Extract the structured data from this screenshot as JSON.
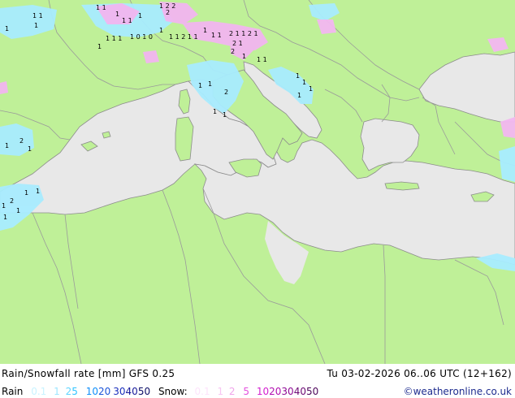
{
  "title": "Rain/Snowfall rate [mm] GFS 0.25",
  "datetime": "Tu 03-02-2026 06..06 UTC (12+162)",
  "credit": "©weatheronline.co.uk",
  "legend": {
    "rain_label": "Rain",
    "rain_steps": [
      {
        "label": "0.1",
        "color": "#c9f3ff"
      },
      {
        "label": "1",
        "color": "#9de6ff"
      },
      {
        "label": "2",
        "color": "#5fd5ff"
      },
      {
        "label": "5",
        "color": "#2ec4ff"
      },
      {
        "label": "10",
        "color": "#0f8ffa"
      },
      {
        "label": "20",
        "color": "#1c55d8"
      },
      {
        "label": "30",
        "color": "#1a2fbc"
      },
      {
        "label": "40",
        "color": "#16199a"
      },
      {
        "label": "50",
        "color": "#0b0d66"
      }
    ],
    "snow_label": "Snow:",
    "snow_steps": [
      {
        "label": "0.1",
        "color": "#fde4fb"
      },
      {
        "label": "1",
        "color": "#f8c6f2"
      },
      {
        "label": "2",
        "color": "#f0a4ea"
      },
      {
        "label": "5",
        "color": "#e34fdd"
      },
      {
        "label": "10",
        "color": "#d41fcf"
      },
      {
        "label": "20",
        "color": "#b10fb0"
      },
      {
        "label": "30",
        "color": "#8f0b95"
      },
      {
        "label": "40",
        "color": "#6c0874"
      },
      {
        "label": "50",
        "color": "#4d055a"
      }
    ]
  },
  "colors": {
    "land": "#bff098",
    "sea": "#e8e8e8",
    "border": "#9a9a9a",
    "rain_light": "#a8ecff",
    "snow_light": "#f2b6f0"
  }
}
